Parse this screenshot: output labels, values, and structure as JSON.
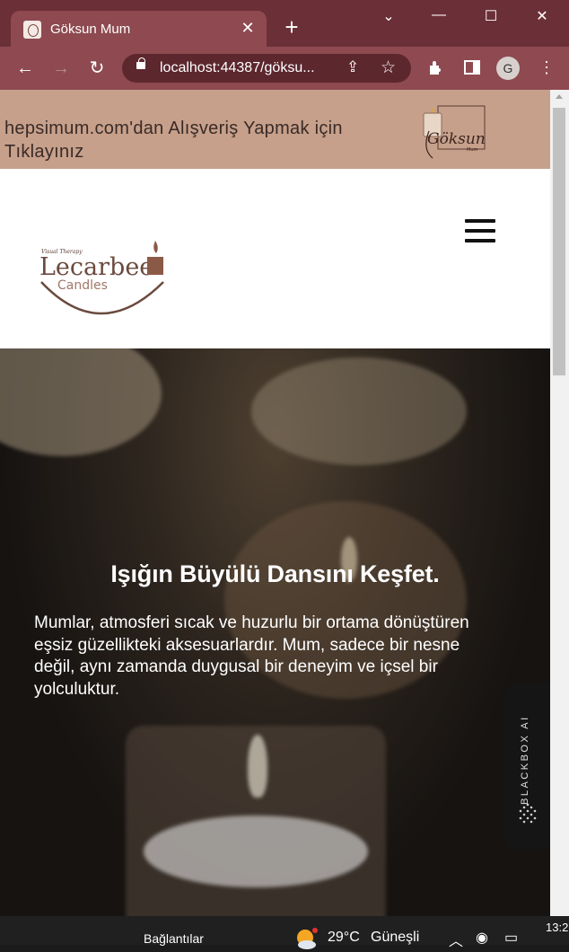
{
  "browser": {
    "tab_title": "Göksun Mum",
    "tab_close": "✕",
    "new_tab": "+",
    "url": "localhost:44387/göksu...",
    "profile_initial": "G",
    "window_controls": {
      "dropdown": "⌄",
      "minimize": "—",
      "maximize": "☐",
      "close": "✕"
    },
    "nav": {
      "back": "←",
      "forward": "→",
      "reload": "↻"
    }
  },
  "promo": {
    "text": "hepsimum.com'dan Alışveriş Yapmak için Tıklayınız",
    "logo_text": "Göksun",
    "logo_sub": "Mum"
  },
  "header": {
    "logo_small": "Visual Therapy",
    "logo_name": "Lecarbee",
    "logo_sub": "Candles"
  },
  "hero": {
    "title": "Işığın Büyülü Dansını Keşfet.",
    "paragraph": "Mumlar, atmosferi sıcak ve huzurlu bir ortama dönüştüren eşsiz güzellikteki aksesuarlardır. Mum, sadece bir nesne değil, aynı zamanda duygusal bir deneyim ve içsel bir yolculuktur."
  },
  "widget": {
    "label": "BLACKBOX AI"
  },
  "taskbar": {
    "links": "Bağlantılar",
    "temperature": "29°C",
    "condition": "Güneşli",
    "clock": "13:2"
  },
  "colors": {
    "tabstrip": "#6b3037",
    "toolbar": "#8e4a50",
    "promo_bg": "#c6a08b",
    "logo_brown": "#7a4a3b"
  }
}
